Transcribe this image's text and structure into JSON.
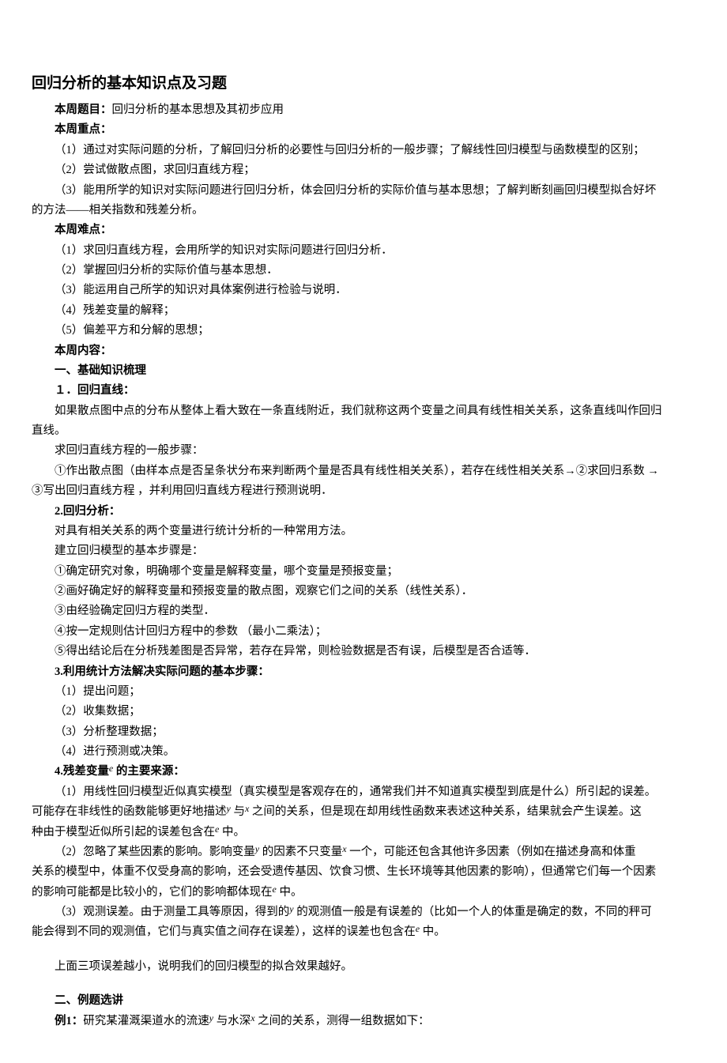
{
  "title": "回归分析的基本知识点及习题",
  "topic_label": "本周题目：",
  "topic_text": "回归分析的基本思想及其初步应用",
  "keypoints_label": "本周重点：",
  "kp1": "（1）通过对实际问题的分析，了解回归分析的必要性与回归分析的一般步骤；了解线性回归模型与函数模型的区别；",
  "kp2": "（2）尝试做散点图，求回归直线方程；",
  "kp3": "（3）能用所学的知识对实际问题进行回归分析，体会回归分析的实际价值与基本思想；了解判断刻画回归模型拟合好坏",
  "kp3b": "的方法——相关指数和残差分析。",
  "diff_label": "本周难点：",
  "d1": "（1）求回归直线方程，会用所学的知识对实际问题进行回归分析．",
  "d2": "（2）掌握回归分析的实际价值与基本思想．",
  "d3": "（3）能运用自己所学的知识对具体案例进行检验与说明．",
  "d4": "（4）残差变量的解释；",
  "d5": "（5）偏差平方和分解的思想；",
  "content_label": "本周内容：",
  "s1_title": "一、基础知识梳理",
  "s1_1_title": "１．回归直线：",
  "s1_1_p1a": "如果散点图中点的分布从整体上看大致在一条直线附近，我们就称这两个变量之间具有线性相关关系，这条直线叫作回归",
  "s1_1_p1b": "直线。",
  "s1_1_p2": "求回归直线方程的一般步骤：",
  "s1_1_p3a": "①作出散点图（由样本点是否呈条状分布来判断两个量是否具有线性相关关系），若存在线性相关关系→②求回归系数 →",
  "s1_1_p3b": "③写出回归直线方程 ，并利用回归直线方程进行预测说明．",
  "s1_2_title": "2.回归分析：",
  "s1_2_p1": "对具有相关关系的两个变量进行统计分析的一种常用方法。",
  "s1_2_p2": "建立回归模型的基本步骤是：",
  "s1_2_p3": "①确定研究对象，明确哪个变量是解释变量，哪个变量是预报变量；",
  "s1_2_p4": "②画好确定好的解释变量和预报变量的散点图，观察它们之间的关系（线性关系）．",
  "s1_2_p5": "③由经验确定回归方程的类型．",
  "s1_2_p6": "④按一定规则估计回归方程中的参数 （最小二乘法）；",
  "s1_2_p7": "⑤得出结论后在分析残差图是否异常，若存在异常，则检验数据是否有误，后模型是否合适等．",
  "s1_3_title": "3.利用统计方法解决实际问题的基本步骤：",
  "s1_3_p1": "（1）提出问题；",
  "s1_3_p2": "（2）收集数据；",
  "s1_3_p3": "（3）分析整理数据；",
  "s1_3_p4": "（4）进行预测或决策。",
  "s1_4_title_a": "4.残差变量",
  "s1_4_title_b": "  的主要来源：",
  "s1_4_p1a": "（1）用线性回归模型近似真实模型（真实模型是客观存在的，通常我们并不知道真实模型到底是什么）所引起的误差。",
  "s1_4_p1b": "可能存在非线性的函数能够更好地描述",
  "s1_4_p1c": "  与",
  "s1_4_p1d": "  之间的关系，但是现在却用线性函数来表述这种关系，结果就会产生误差。这",
  "s1_4_p1e": "种由于模型近似所引起的误差包含在",
  "s1_4_p1f": "  中。",
  "s1_4_p2a": "（2）忽略了某些因素的影响。影响变量",
  "s1_4_p2b": "  的因素不只变量",
  "s1_4_p2c": "  一个，可能还包含其他许多因素（例如在描述身高和体重",
  "s1_4_p2d": "关系的模型中，体重不仅受身高的影响，还会受遗传基因、饮食习惯、生长环境等其他因素的影响），但通常它们每一个因素",
  "s1_4_p2e": "的影响可能都是比较小的，它们的影响都体现在",
  "s1_4_p2f": "  中。",
  "s1_4_p3a": "（3）观测误差。由于测量工具等原因，得到的",
  "s1_4_p3b": "  的观测值一般是有误差的（比如一个人的体重是确定的数，不同的秤可",
  "s1_4_p3c": "能会得到不同的观测值，它们与真实值之间存在误差），这样的误差也包含在",
  "s1_4_p3d": "  中。",
  "s1_4_p4": "上面三项误差越小，说明我们的回归模型的拟合效果越好。",
  "s2_title": "二、例题选讲",
  "s2_ex1_a": "例",
  "s2_ex1_b": "1：",
  "s2_ex1_c": "研究某灌溉渠道水的流速",
  "s2_ex1_d": "  与水深",
  "s2_ex1_e": "  之间的关系，测得一组数据如下：",
  "var_y": "y",
  "var_x": "x",
  "var_e": "e"
}
